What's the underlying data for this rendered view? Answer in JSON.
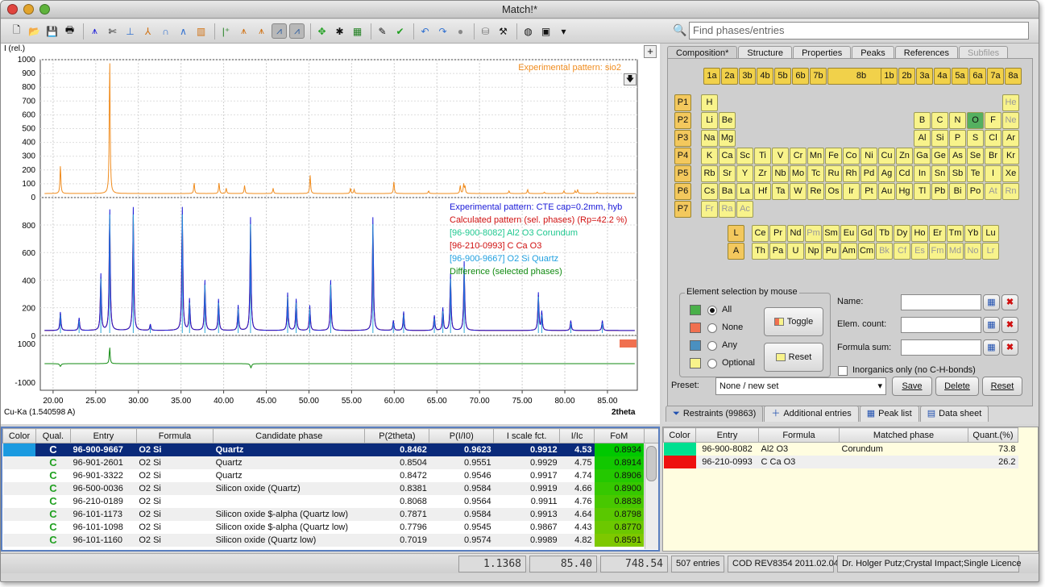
{
  "window": {
    "title": "Match!*"
  },
  "search": {
    "placeholder": "Find phases/entries"
  },
  "plot": {
    "ylabel": "I (rel.)",
    "xlabel": "2theta",
    "wavelength": "Cu-Ka (1.540598 A)",
    "top_yticks": [
      "1000",
      "900",
      "800",
      "700",
      "600",
      "500",
      "400",
      "300",
      "200",
      "100",
      "0"
    ],
    "mid_yticks": [
      "800",
      "600",
      "400",
      "200",
      "0"
    ],
    "diff_yticks": [
      "1000",
      "-1000"
    ],
    "xticks": [
      "20.00",
      "25.00",
      "30.00",
      "35.00",
      "40.00",
      "45.00",
      "50.00",
      "55.00",
      "60.00",
      "65.00",
      "70.00",
      "75.00",
      "80.00",
      "85.00"
    ],
    "exp_label": "Experimental pattern: sio2",
    "legend": [
      {
        "text": "Experimental pattern: CTE cap=0.2mm, hyb",
        "color": "#1a1ad8"
      },
      {
        "text": "Calculated pattern (sel. phases) (Rp=42.2 %)",
        "color": "#d01010"
      },
      {
        "text": "[96-900-8082] Al2 O3  Corundum",
        "color": "#20c890"
      },
      {
        "text": "[96-210-0993] C Ca O3",
        "color": "#d01010"
      },
      {
        "text": "[96-900-9667] O2 Si Quartz",
        "color": "#20a0e0"
      },
      {
        "text": "Difference (selected phases)",
        "color": "#108a10"
      }
    ],
    "colors": {
      "exp": "#f08c1e",
      "blue": "#1a1ad8",
      "red": "#c01010",
      "green": "#108a10"
    }
  },
  "tabs": [
    "Composition*",
    "Structure",
    "Properties",
    "Peaks",
    "References",
    "Subfiles"
  ],
  "groups": [
    "1a",
    "2a",
    "3b",
    "4b",
    "5b",
    "6b",
    "7b",
    "8b",
    "1b",
    "2b",
    "3a",
    "4a",
    "5a",
    "6a",
    "7a",
    "8a"
  ],
  "periods": [
    "P1",
    "P2",
    "P3",
    "P4",
    "P5",
    "P6",
    "P7"
  ],
  "rows": [
    [
      "H",
      "",
      "",
      "",
      "",
      "",
      "",
      "",
      "",
      "",
      "",
      "",
      "",
      "",
      "",
      "",
      "",
      "He"
    ],
    [
      "Li",
      "Be",
      "",
      "",
      "",
      "",
      "",
      "",
      "",
      "",
      "",
      "",
      "B",
      "C",
      "N",
      "O",
      "F",
      "Ne"
    ],
    [
      "Na",
      "Mg",
      "",
      "",
      "",
      "",
      "",
      "",
      "",
      "",
      "",
      "",
      "Al",
      "Si",
      "P",
      "S",
      "Cl",
      "Ar"
    ],
    [
      "K",
      "Ca",
      "Sc",
      "Ti",
      "V",
      "Cr",
      "Mn",
      "Fe",
      "Co",
      "Ni",
      "Cu",
      "Zn",
      "Ga",
      "Ge",
      "As",
      "Se",
      "Br",
      "Kr"
    ],
    [
      "Rb",
      "Sr",
      "Y",
      "Zr",
      "Nb",
      "Mo",
      "Tc",
      "Ru",
      "Rh",
      "Pd",
      "Ag",
      "Cd",
      "In",
      "Sn",
      "Sb",
      "Te",
      "I",
      "Xe"
    ],
    [
      "Cs",
      "Ba",
      "La",
      "Hf",
      "Ta",
      "W",
      "Re",
      "Os",
      "Ir",
      "Pt",
      "Au",
      "Hg",
      "Tl",
      "Pb",
      "Bi",
      "Po",
      "At",
      "Rn"
    ],
    [
      "Fr",
      "Ra",
      "Ac",
      "",
      "",
      "",
      "",
      "",
      "",
      "",
      "",
      "",
      "",
      "",
      "",
      "",
      "",
      ""
    ]
  ],
  "lanth": [
    "Ce",
    "Pr",
    "Nd",
    "Pm",
    "Sm",
    "Eu",
    "Gd",
    "Tb",
    "Dy",
    "Ho",
    "Er",
    "Tm",
    "Yb",
    "Lu"
  ],
  "actin": [
    "Th",
    "Pa",
    "U",
    "Np",
    "Pu",
    "Am",
    "Cm",
    "Bk",
    "Cf",
    "Es",
    "Fm",
    "Md",
    "No",
    "Lr"
  ],
  "dim": [
    "He",
    "Ne",
    "Fr",
    "Ra",
    "Ac",
    "Pm",
    "Bk",
    "Cf",
    "Es",
    "Fm",
    "Md",
    "No",
    "Lr",
    "At",
    "Rn"
  ],
  "selected_el": "O",
  "lrows": [
    "L",
    "A"
  ],
  "elsel": {
    "title": "Element selection by mouse",
    "opts": [
      "All",
      "None",
      "Any",
      "Optional"
    ],
    "colors": [
      "#4ab04a",
      "#f07050",
      "#4a90c0",
      "#f8f38b"
    ],
    "toggle": "Toggle",
    "reset": "Reset"
  },
  "fields": {
    "name": "Name:",
    "count": "Elem. count:",
    "sum": "Formula sum:",
    "inorg": "Inorganics only (no C-H-bonds)"
  },
  "preset": {
    "label": "Preset:",
    "value": "None / new set",
    "save": "Save",
    "delete": "Delete",
    "reset": "Reset"
  },
  "btabs": [
    "Restraints (99863)",
    "Additional entries",
    "Peak list",
    "Data sheet"
  ],
  "cand_headers": [
    "Color",
    "Qual.",
    "Entry",
    "Formula",
    "Candidate phase",
    "P(2theta)",
    "P(I/I0)",
    "I scale fct.",
    "I/Ic",
    "FoM"
  ],
  "cand": [
    [
      "C",
      "96-900-9667",
      "O2 Si",
      "Quartz",
      "0.8462",
      "0.9623",
      "0.9912",
      "4.53",
      "0.8934"
    ],
    [
      "C",
      "96-901-2601",
      "O2 Si",
      "Quartz",
      "0.8504",
      "0.9551",
      "0.9929",
      "4.75",
      "0.8914"
    ],
    [
      "C",
      "96-901-3322",
      "O2 Si",
      "Quartz",
      "0.8472",
      "0.9546",
      "0.9917",
      "4.74",
      "0.8906"
    ],
    [
      "C",
      "96-500-0036",
      "O2 Si",
      "Silicon oxide (Quartz)",
      "0.8381",
      "0.9584",
      "0.9919",
      "4.66",
      "0.8900"
    ],
    [
      "C",
      "96-210-0189",
      "O2 Si",
      "",
      "0.8068",
      "0.9564",
      "0.9911",
      "4.76",
      "0.8838"
    ],
    [
      "C",
      "96-101-1173",
      "O2 Si",
      "Silicon oxide $-alpha (Quartz low)",
      "0.7871",
      "0.9584",
      "0.9913",
      "4.64",
      "0.8798"
    ],
    [
      "C",
      "96-101-1098",
      "O2 Si",
      "Silicon oxide $-alpha (Quartz low)",
      "0.7796",
      "0.9545",
      "0.9867",
      "4.43",
      "0.8770"
    ],
    [
      "C",
      "96-101-1160",
      "O2 Si",
      "Silicon oxide (Quartz low)",
      "0.7019",
      "0.9574",
      "0.9989",
      "4.82",
      "0.8591"
    ]
  ],
  "match_headers": [
    "Color",
    "Entry",
    "Formula",
    "Matched phase",
    "Quant.(%)"
  ],
  "match": [
    {
      "color": "#00e090",
      "entry": "96-900-8082",
      "formula": "Al2 O3",
      "phase": "Corundum",
      "quant": "73.8"
    },
    {
      "color": "#ee1010",
      "entry": "96-210-0993",
      "formula": "C Ca O3",
      "phase": "",
      "quant": "26.2"
    }
  ],
  "status": {
    "a": "1.1368",
    "b": "85.40",
    "c": "748.54",
    "entries": "507 entries",
    "cod": "COD REV8354 2011.02.04",
    "user": "Dr. Holger Putz;Crystal Impact;Single Licence"
  }
}
